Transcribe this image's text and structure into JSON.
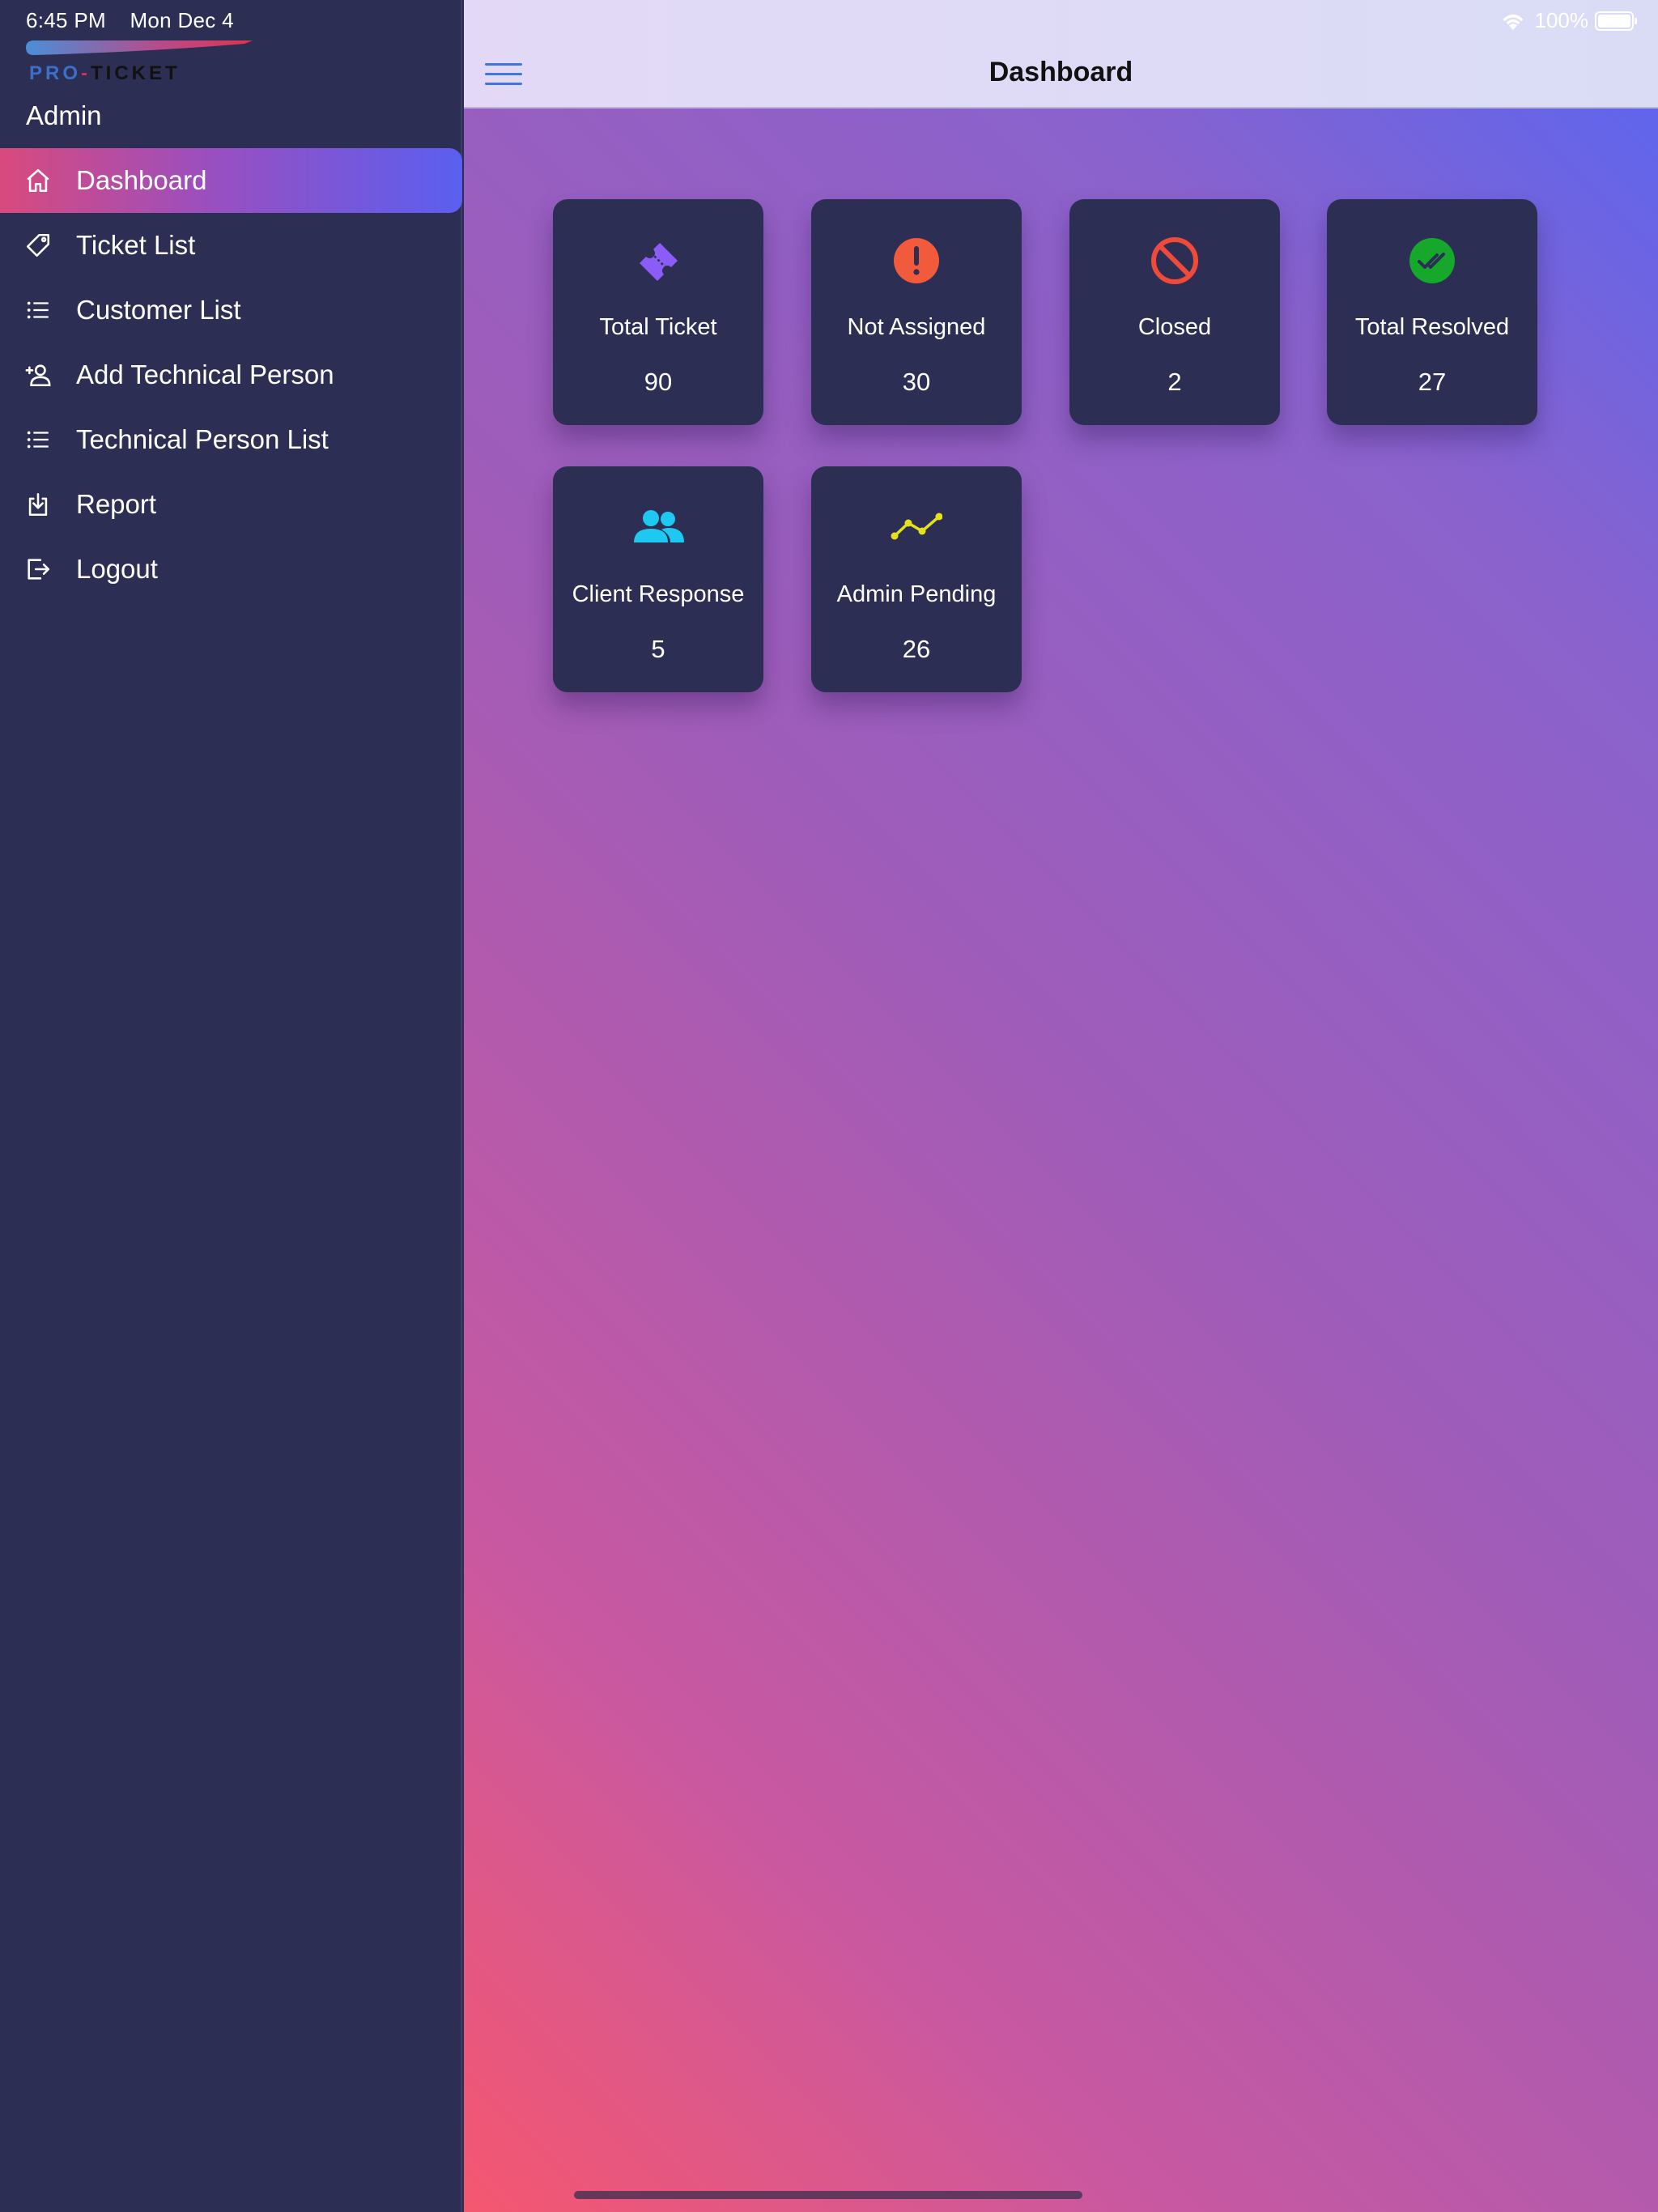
{
  "status": {
    "time": "6:45 PM",
    "date": "Mon Dec 4",
    "battery": "100%"
  },
  "brand": {
    "name": "PRO-TICKET",
    "role": "Admin"
  },
  "nav": {
    "items": [
      {
        "label": "Dashboard",
        "icon": "home-icon",
        "active": true
      },
      {
        "label": "Ticket List",
        "icon": "ticket-tag-icon"
      },
      {
        "label": "Customer List",
        "icon": "list-icon"
      },
      {
        "label": "Add Technical Person",
        "icon": "add-person-icon"
      },
      {
        "label": "Technical Person List",
        "icon": "list-icon"
      },
      {
        "label": "Report",
        "icon": "download-icon"
      },
      {
        "label": "Logout",
        "icon": "logout-icon"
      }
    ]
  },
  "header": {
    "title": "Dashboard"
  },
  "cards": [
    {
      "label": "Total Ticket",
      "value": "90",
      "icon": "ticket-icon",
      "color": "#8b5cf6"
    },
    {
      "label": "Not Assigned",
      "value": "30",
      "icon": "alert-circle-icon",
      "color": "#f25a3c"
    },
    {
      "label": "Closed",
      "value": "2",
      "icon": "ban-icon",
      "color": "#f04a3a"
    },
    {
      "label": "Total Resolved",
      "value": "27",
      "icon": "double-check-icon",
      "color": "#16a82a"
    },
    {
      "label": "Client Response",
      "value": "5",
      "icon": "users-icon",
      "color": "#1ec8f0"
    },
    {
      "label": "Admin Pending",
      "value": "26",
      "icon": "trend-line-icon",
      "color": "#e5e21a"
    }
  ]
}
